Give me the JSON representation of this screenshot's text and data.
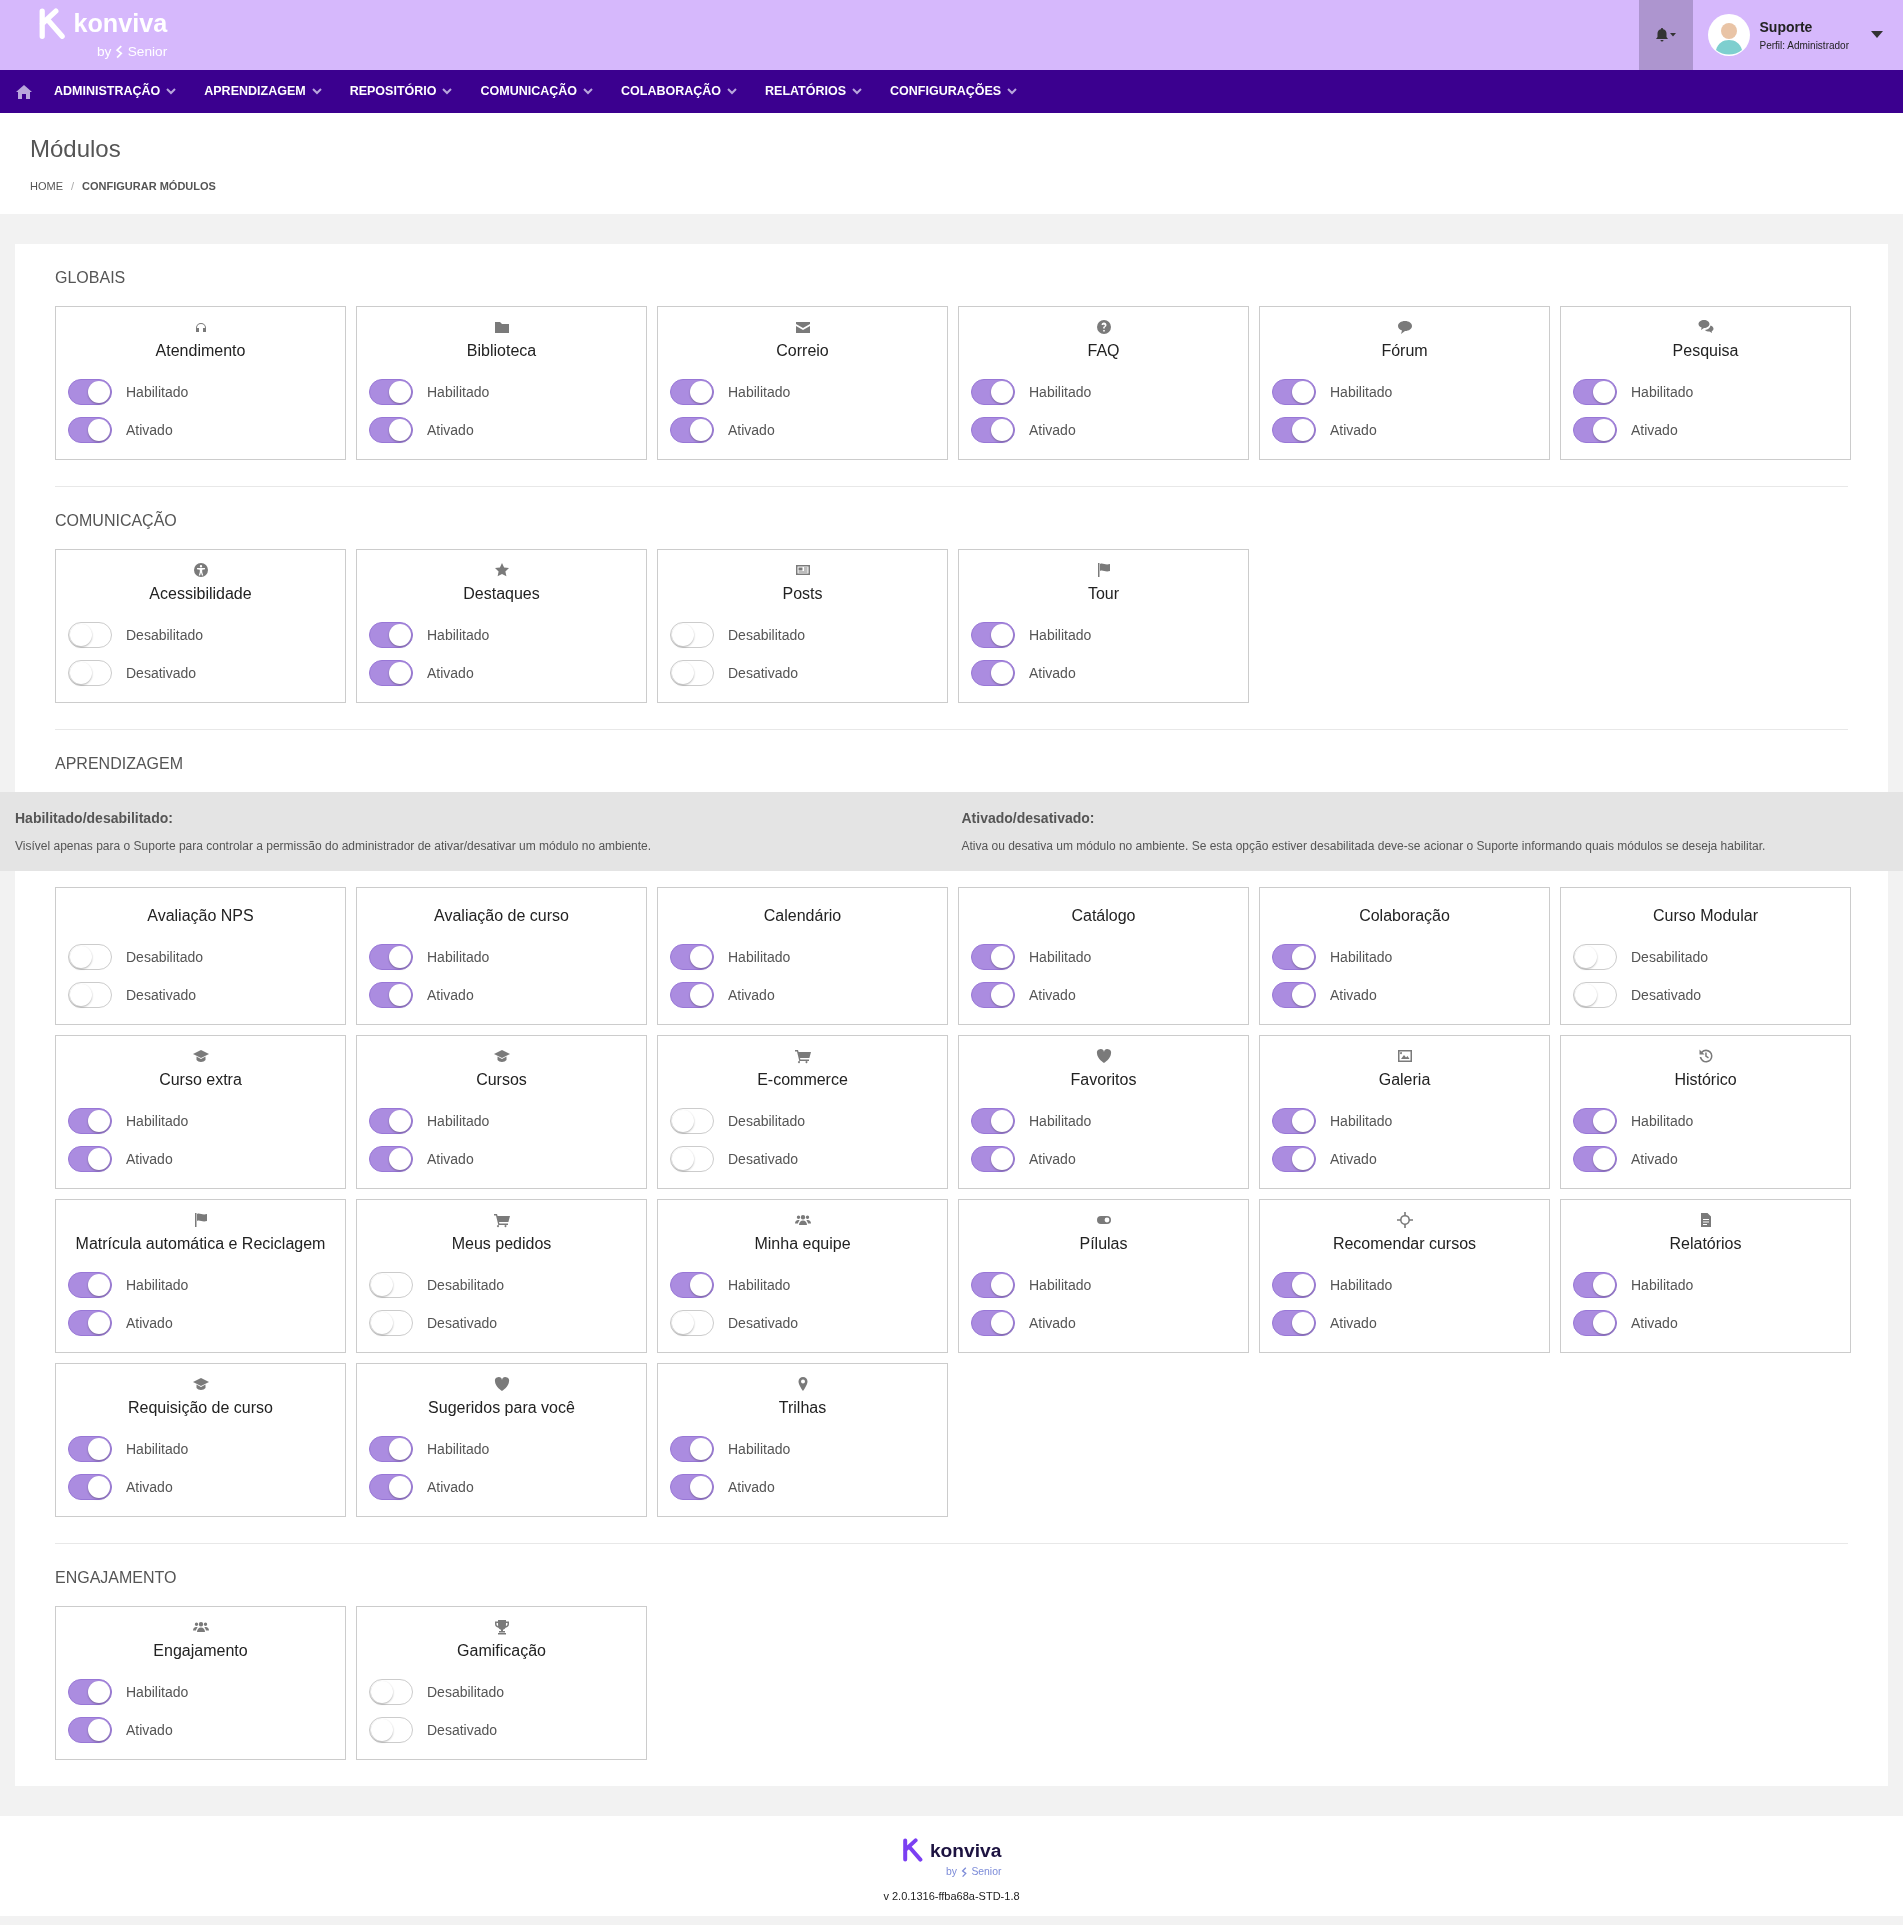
{
  "header": {
    "logo": {
      "name": "konviva",
      "by": "by",
      "brand": "Senior"
    },
    "user": {
      "name": "Suporte",
      "profile": "Perfil: Administrador"
    }
  },
  "nav": [
    "ADMINISTRAÇÃO",
    "APRENDIZAGEM",
    "REPOSITÓRIO",
    "COMUNICAÇÃO",
    "COLABORAÇÃO",
    "RELATÓRIOS",
    "CONFIGURAÇÕES"
  ],
  "page": {
    "title": "Módulos",
    "breadcrumb_separator": "/",
    "breadcrumb": [
      {
        "label": "HOME",
        "selected": false
      },
      {
        "label": "CONFIGURAR MÓDULOS",
        "selected": true
      }
    ]
  },
  "sections": [
    {
      "title": "GLOBAIS",
      "modules": [
        {
          "name": "Atendimento",
          "kind": "headset",
          "toggles": [
            {
              "label": "Habilitado",
              "on": true
            },
            {
              "label": "Ativado",
              "on": true
            }
          ]
        },
        {
          "name": "Biblioteca",
          "kind": "folder",
          "toggles": [
            {
              "label": "Habilitado",
              "on": true
            },
            {
              "label": "Ativado",
              "on": true
            }
          ]
        },
        {
          "name": "Correio",
          "kind": "envelope",
          "toggles": [
            {
              "label": "Habilitado",
              "on": true
            },
            {
              "label": "Ativado",
              "on": true
            }
          ]
        },
        {
          "name": "FAQ",
          "kind": "question",
          "toggles": [
            {
              "label": "Habilitado",
              "on": true
            },
            {
              "label": "Ativado",
              "on": true
            }
          ]
        },
        {
          "name": "Fórum",
          "kind": "bubble",
          "toggles": [
            {
              "label": "Habilitado",
              "on": true
            },
            {
              "label": "Ativado",
              "on": true
            }
          ]
        },
        {
          "name": "Pesquisa",
          "kind": "bubbles",
          "toggles": [
            {
              "label": "Habilitado",
              "on": true
            },
            {
              "label": "Ativado",
              "on": true
            }
          ]
        }
      ]
    },
    {
      "title": "COMUNICAÇÃO",
      "modules": [
        {
          "name": "Acessibilidade",
          "kind": "accessibility",
          "toggles": [
            {
              "label": "Desabilitado",
              "on": false
            },
            {
              "label": "Desativado",
              "on": false
            }
          ]
        },
        {
          "name": "Destaques",
          "kind": "star",
          "toggles": [
            {
              "label": "Habilitado",
              "on": true
            },
            {
              "label": "Ativado",
              "on": true
            }
          ]
        },
        {
          "name": "Posts",
          "kind": "newspaper",
          "toggles": [
            {
              "label": "Desabilitado",
              "on": false
            },
            {
              "label": "Desativado",
              "on": false
            }
          ]
        },
        {
          "name": "Tour",
          "kind": "flag",
          "toggles": [
            {
              "label": "Habilitado",
              "on": true
            },
            {
              "label": "Ativado",
              "on": true
            }
          ]
        }
      ]
    },
    {
      "title": "APRENDIZAGEM",
      "notice": [
        {
          "title": "Habilitado/desabilitado:",
          "text": "Visível apenas para o Suporte para controlar a permissão do administrador de ativar/desativar um módulo no ambiente."
        },
        {
          "title": "Ativado/desativado:",
          "text": "Ativa ou desativa um módulo no ambiente. Se esta opção estiver desabilitada deve-se acionar o Suporte informando quais módulos se deseja habilitar."
        }
      ],
      "modules": [
        {
          "name": "Avaliação NPS",
          "toggles": [
            {
              "label": "Desabilitado",
              "on": false
            },
            {
              "label": "Desativado",
              "on": false
            }
          ]
        },
        {
          "name": "Avaliação de curso",
          "toggles": [
            {
              "label": "Habilitado",
              "on": true
            },
            {
              "label": "Ativado",
              "on": true
            }
          ]
        },
        {
          "name": "Calendário",
          "toggles": [
            {
              "label": "Habilitado",
              "on": true
            },
            {
              "label": "Ativado",
              "on": true
            }
          ]
        },
        {
          "name": "Catálogo",
          "toggles": [
            {
              "label": "Habilitado",
              "on": true
            },
            {
              "label": "Ativado",
              "on": true
            }
          ]
        },
        {
          "name": "Colaboração",
          "toggles": [
            {
              "label": "Habilitado",
              "on": true
            },
            {
              "label": "Ativado",
              "on": true
            }
          ]
        },
        {
          "name": "Curso Modular",
          "toggles": [
            {
              "label": "Desabilitado",
              "on": false
            },
            {
              "label": "Desativado",
              "on": false
            }
          ]
        },
        {
          "name": "Curso extra",
          "kind": "cap",
          "toggles": [
            {
              "label": "Habilitado",
              "on": true
            },
            {
              "label": "Ativado",
              "on": true
            }
          ]
        },
        {
          "name": "Cursos",
          "kind": "cap",
          "toggles": [
            {
              "label": "Habilitado",
              "on": true
            },
            {
              "label": "Ativado",
              "on": true
            }
          ]
        },
        {
          "name": "E-commerce",
          "kind": "cart",
          "toggles": [
            {
              "label": "Desabilitado",
              "on": false
            },
            {
              "label": "Desativado",
              "on": false
            }
          ]
        },
        {
          "name": "Favoritos",
          "kind": "heart",
          "toggles": [
            {
              "label": "Habilitado",
              "on": true
            },
            {
              "label": "Ativado",
              "on": true
            }
          ]
        },
        {
          "name": "Galeria",
          "kind": "image",
          "toggles": [
            {
              "label": "Habilitado",
              "on": true
            },
            {
              "label": "Ativado",
              "on": true
            }
          ]
        },
        {
          "name": "Histórico",
          "kind": "history",
          "toggles": [
            {
              "label": "Habilitado",
              "on": true
            },
            {
              "label": "Ativado",
              "on": true
            }
          ]
        },
        {
          "name": "Matrícula automática e Reciclagem",
          "kind": "flag",
          "toggles": [
            {
              "label": "Habilitado",
              "on": true
            },
            {
              "label": "Ativado",
              "on": true
            }
          ]
        },
        {
          "name": "Meus pedidos",
          "kind": "cart",
          "toggles": [
            {
              "label": "Desabilitado",
              "on": false
            },
            {
              "label": "Desativado",
              "on": false
            }
          ]
        },
        {
          "name": "Minha equipe",
          "kind": "people",
          "toggles": [
            {
              "label": "Habilitado",
              "on": true
            },
            {
              "label": "Desativado",
              "on": false
            }
          ]
        },
        {
          "name": "Pílulas",
          "kind": "toggle",
          "toggles": [
            {
              "label": "Habilitado",
              "on": true
            },
            {
              "label": "Ativado",
              "on": true
            }
          ]
        },
        {
          "name": "Recomendar cursos",
          "kind": "crosshair",
          "toggles": [
            {
              "label": "Habilitado",
              "on": true
            },
            {
              "label": "Ativado",
              "on": true
            }
          ]
        },
        {
          "name": "Relatórios",
          "kind": "document",
          "toggles": [
            {
              "label": "Habilitado",
              "on": true
            },
            {
              "label": "Ativado",
              "on": true
            }
          ]
        },
        {
          "name": "Requisição de curso",
          "kind": "cap",
          "toggles": [
            {
              "label": "Habilitado",
              "on": true
            },
            {
              "label": "Ativado",
              "on": true
            }
          ]
        },
        {
          "name": "Sugeridos para você",
          "kind": "heart",
          "toggles": [
            {
              "label": "Habilitado",
              "on": true
            },
            {
              "label": "Ativado",
              "on": true
            }
          ]
        },
        {
          "name": "Trilhas",
          "kind": "pin",
          "toggles": [
            {
              "label": "Habilitado",
              "on": true
            },
            {
              "label": "Ativado",
              "on": true
            }
          ]
        }
      ]
    },
    {
      "title": "ENGAJAMENTO",
      "modules": [
        {
          "name": "Engajamento",
          "kind": "people",
          "toggles": [
            {
              "label": "Habilitado",
              "on": true
            },
            {
              "label": "Ativado",
              "on": true
            }
          ]
        },
        {
          "name": "Gamificação",
          "kind": "trophy",
          "toggles": [
            {
              "label": "Desabilitado",
              "on": false
            },
            {
              "label": "Desativado",
              "on": false
            }
          ]
        }
      ]
    }
  ],
  "footer": {
    "logo": {
      "name": "konviva",
      "by": "by",
      "brand": "Senior"
    },
    "version": "v 2.0.1316-ffba68a-STD-1.8"
  }
}
